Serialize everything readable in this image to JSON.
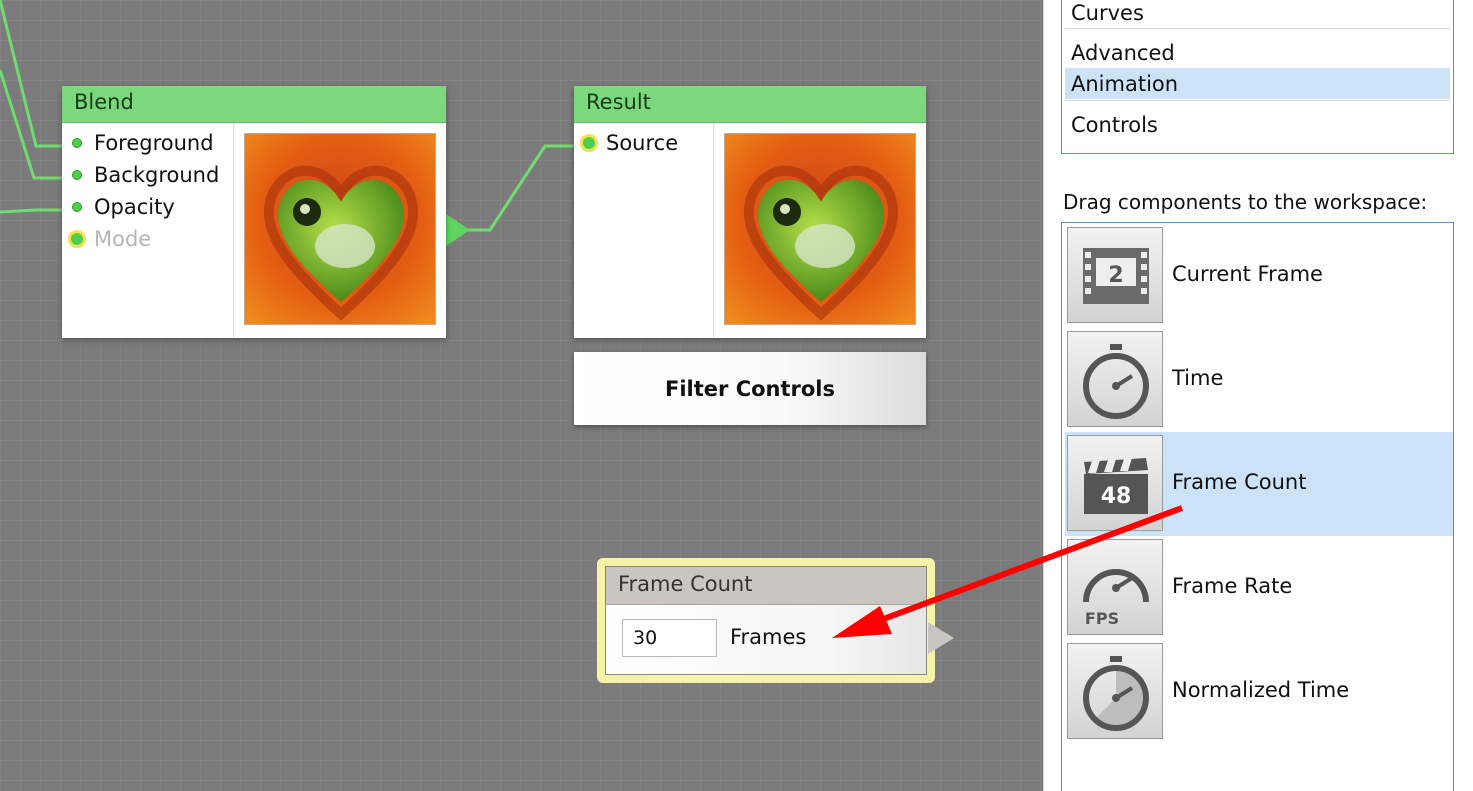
{
  "blend_node": {
    "title": "Blend",
    "ports": [
      "Foreground",
      "Background",
      "Opacity",
      "Mode"
    ]
  },
  "result_node": {
    "title": "Result",
    "ports": [
      "Source"
    ]
  },
  "filter_controls": {
    "label": "Filter Controls"
  },
  "frame_count_node": {
    "title": "Frame Count",
    "value": "30",
    "unit_label": "Frames"
  },
  "categories": {
    "items": [
      "Curves",
      "Advanced",
      "Animation",
      "Controls"
    ],
    "selected": "Animation"
  },
  "drag_hint": "Drag components to the workspace:",
  "components": {
    "items": [
      {
        "label": "Current Frame",
        "icon": "film-frame-icon",
        "icon_text": "2"
      },
      {
        "label": "Time",
        "icon": "stopwatch-icon"
      },
      {
        "label": "Frame Count",
        "icon": "clapperboard-icon",
        "icon_text": "48"
      },
      {
        "label": "Frame Rate",
        "icon": "speedometer-icon",
        "icon_text": "FPS"
      },
      {
        "label": "Normalized Time",
        "icon": "stopwatch-pie-icon"
      }
    ],
    "selected": "Frame Count"
  },
  "colors": {
    "node_header": "#7cd87c",
    "wire": "#6fdc6f",
    "selection": "#cce3f7",
    "annotation_arrow": "#ff0000",
    "highlight_border": "#f7f3a6"
  }
}
